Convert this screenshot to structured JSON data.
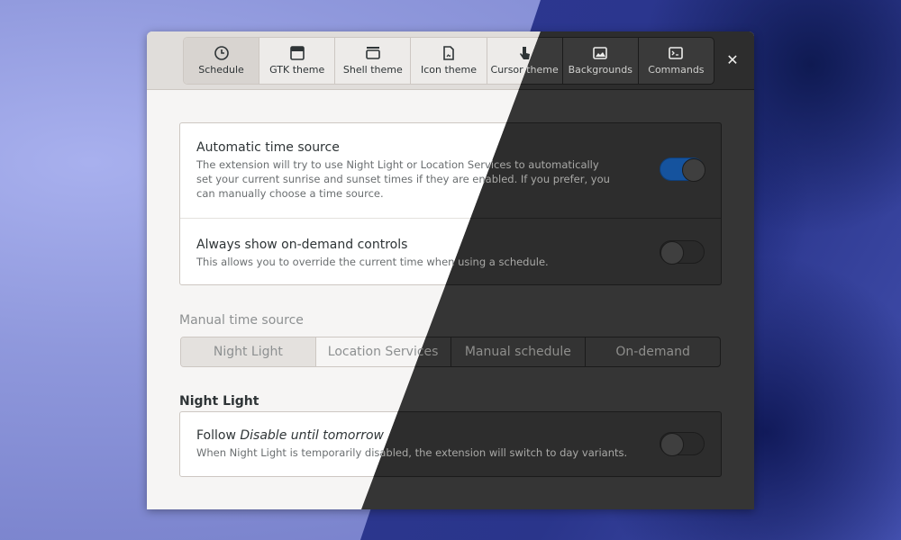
{
  "window": {
    "tabs": [
      {
        "label": "Schedule",
        "icon": "clock-icon",
        "active": true
      },
      {
        "label": "GTK theme",
        "icon": "window-icon",
        "active": false
      },
      {
        "label": "Shell theme",
        "icon": "panel-icon",
        "active": false
      },
      {
        "label": "Icon theme",
        "icon": "file-icon",
        "active": false
      },
      {
        "label": "Cursor theme",
        "icon": "pointer-icon",
        "active": false
      },
      {
        "label": "Backgrounds",
        "icon": "image-icon",
        "active": false
      },
      {
        "label": "Commands",
        "icon": "terminal-icon",
        "active": false
      }
    ],
    "close_label": "✕"
  },
  "settings": {
    "auto_time": {
      "title": "Automatic time source",
      "desc_lines": [
        "The extension will try to use Night Light or Location Services to automatically",
        "set your current sunrise and sunset times if they are enabled. If you prefer, you",
        "can manually choose a time source."
      ],
      "enabled": true
    },
    "on_demand": {
      "title": "Always show on-demand controls",
      "desc": "This allows you to override the current time when using a schedule.",
      "enabled": false
    }
  },
  "manual_source": {
    "header": "Manual time source",
    "options": [
      "Night Light",
      "Location Services",
      "Manual schedule",
      "On-demand"
    ],
    "selected": "Night Light"
  },
  "night_light": {
    "header": "Night Light",
    "follow": {
      "title_prefix": "Follow ",
      "title_emphasis": "Disable until tomorrow",
      "desc": "When Night Light is temporarily disabled, the extension will switch to day variants.",
      "enabled": false
    }
  },
  "colors": {
    "accent_light": "#3584e4",
    "accent_dark": "#15539e"
  }
}
